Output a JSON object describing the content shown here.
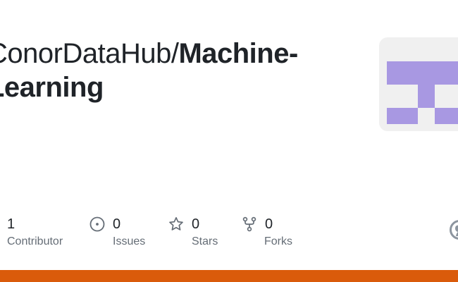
{
  "repo": {
    "owner": "ConorDataHub/",
    "name_line1": "Machine-",
    "name_line2": "Learning"
  },
  "avatar": {
    "color": "#a898e2",
    "background": "#f0f0f0"
  },
  "stats": {
    "contributors": {
      "value": "1",
      "label": "Contributor"
    },
    "issues": {
      "value": "0",
      "label": "Issues",
      "icon": "issue-opened-icon"
    },
    "stars": {
      "value": "0",
      "label": "Stars",
      "icon": "star-icon"
    },
    "forks": {
      "value": "0",
      "label": "Forks",
      "icon": "repo-forked-icon"
    }
  },
  "brand_logo": "github-logo-icon",
  "language_bar": {
    "color": "#da5b0b"
  }
}
